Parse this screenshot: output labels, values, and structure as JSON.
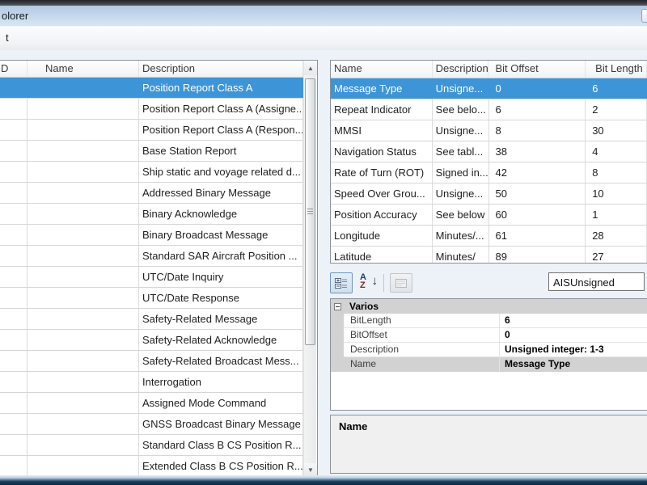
{
  "window": {
    "title_partial": "olorer",
    "menu_partial": "t"
  },
  "colors": {
    "selection_blue": "#3d94d6",
    "titlebar_blue": "#c6d9ec",
    "category_gray": "#d2d2d2",
    "bottom_border_navy": "#16344f"
  },
  "left_table": {
    "columns": {
      "id": "D",
      "name": "Name",
      "description": "Description"
    },
    "selected_index": 0,
    "rows": [
      {
        "id": "",
        "name": "",
        "description": "Position Report Class A"
      },
      {
        "id": "",
        "name": "",
        "description": "Position Report Class A (Assigne..."
      },
      {
        "id": "",
        "name": "",
        "description": "Position Report Class A (Respon..."
      },
      {
        "id": "",
        "name": "",
        "description": "Base Station Report"
      },
      {
        "id": "",
        "name": "",
        "description": "Ship static and voyage related d..."
      },
      {
        "id": "",
        "name": "",
        "description": "Addressed Binary Message"
      },
      {
        "id": "",
        "name": "",
        "description": "Binary Acknowledge"
      },
      {
        "id": "",
        "name": "",
        "description": "Binary Broadcast Message"
      },
      {
        "id": "",
        "name": "",
        "description": "Standard SAR Aircraft Position ..."
      },
      {
        "id": "",
        "name": "",
        "description": "UTC/Date Inquiry"
      },
      {
        "id": "",
        "name": "",
        "description": "UTC/Date Response"
      },
      {
        "id": "",
        "name": "",
        "description": "Safety-Related Message"
      },
      {
        "id": "",
        "name": "",
        "description": "Safety-Related Acknowledge"
      },
      {
        "id": "",
        "name": "",
        "description": "Safety-Related Broadcast Mess..."
      },
      {
        "id": "",
        "name": "",
        "description": "Interrogation"
      },
      {
        "id": "",
        "name": "",
        "description": "Assigned Mode Command"
      },
      {
        "id": "",
        "name": "",
        "description": "GNSS Broadcast Binary Message"
      },
      {
        "id": "",
        "name": "",
        "description": "Standard Class B CS Position R..."
      },
      {
        "id": "",
        "name": "",
        "description": "Extended Class B CS Position R..."
      }
    ],
    "scrollbar": {
      "up_glyph": "▲",
      "down_glyph": "▼"
    }
  },
  "right_table": {
    "columns": {
      "name": "Name",
      "description": "Description",
      "bit_offset": "Bit Offset",
      "bit_length": "Bit Length"
    },
    "selected_index": 0,
    "rows": [
      {
        "name": "Message Type",
        "description": "Unsigne...",
        "bit_offset": "0",
        "bit_length": "6"
      },
      {
        "name": "Repeat Indicator",
        "description": "See belo...",
        "bit_offset": "6",
        "bit_length": "2"
      },
      {
        "name": "MMSI",
        "description": "Unsigne...",
        "bit_offset": "8",
        "bit_length": "30"
      },
      {
        "name": "Navigation Status",
        "description": "See tabl...",
        "bit_offset": "38",
        "bit_length": "4"
      },
      {
        "name": "Rate of Turn (ROT)",
        "description": "Signed in...",
        "bit_offset": "42",
        "bit_length": "8"
      },
      {
        "name": "Speed Over Grou...",
        "description": "Unsigne...",
        "bit_offset": "50",
        "bit_length": "10"
      },
      {
        "name": "Position Accuracy",
        "description": "See below",
        "bit_offset": "60",
        "bit_length": "1"
      },
      {
        "name": "Longitude",
        "description": "Minutes/...",
        "bit_offset": "61",
        "bit_length": "28"
      },
      {
        "name": "Latitude",
        "description": "Minutes/",
        "bit_offset": "89",
        "bit_length": "27"
      }
    ]
  },
  "property_panel": {
    "type_box_value": "AISUnsigned",
    "category_label": "Varios",
    "selected_index": 3,
    "properties": [
      {
        "label": "BitLength",
        "value": "6"
      },
      {
        "label": "BitOffset",
        "value": "0"
      },
      {
        "label": "Description",
        "value": "Unsigned integer: 1-3"
      },
      {
        "label": "Name",
        "value": "Message Type"
      }
    ],
    "help_title": "Name",
    "sort_icon": {
      "a": "A",
      "z": "Z",
      "arrow": "↓"
    }
  }
}
